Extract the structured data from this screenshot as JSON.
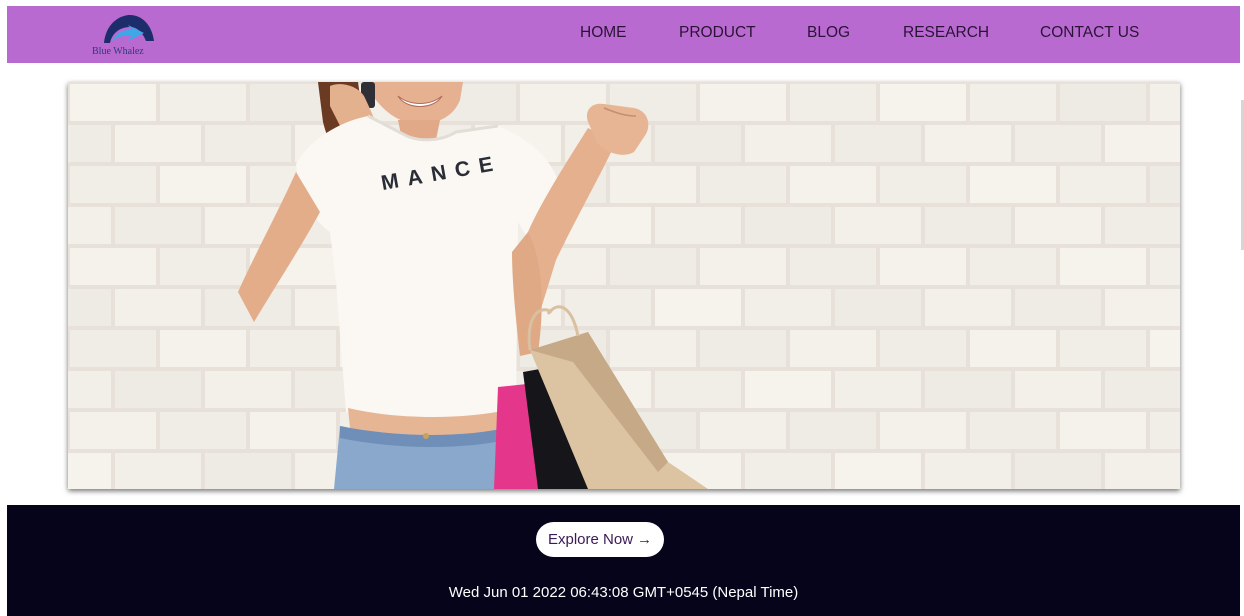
{
  "colors": {
    "navbar": "#b96ad0",
    "nav_text": "#2a1336",
    "footer_band": "#05041a",
    "button_bg": "#ffffff",
    "button_text": "#3b1a55",
    "datetime_text": "#ffffff"
  },
  "brand": {
    "name": "Blue Whalez",
    "icon": "whale-logo-icon"
  },
  "nav": {
    "items": [
      {
        "label": "HOME"
      },
      {
        "label": "PRODUCT"
      },
      {
        "label": "BLOG"
      },
      {
        "label": "RESEARCH"
      },
      {
        "label": "CONTACT US"
      }
    ]
  },
  "hero": {
    "shirt_text": "MANCE"
  },
  "cta": {
    "label": "Explore Now",
    "arrow": "→",
    "icon": "arrow-right-icon"
  },
  "datetime": "Wed Jun 01 2022 06:43:08 GMT+0545 (Nepal Time)"
}
